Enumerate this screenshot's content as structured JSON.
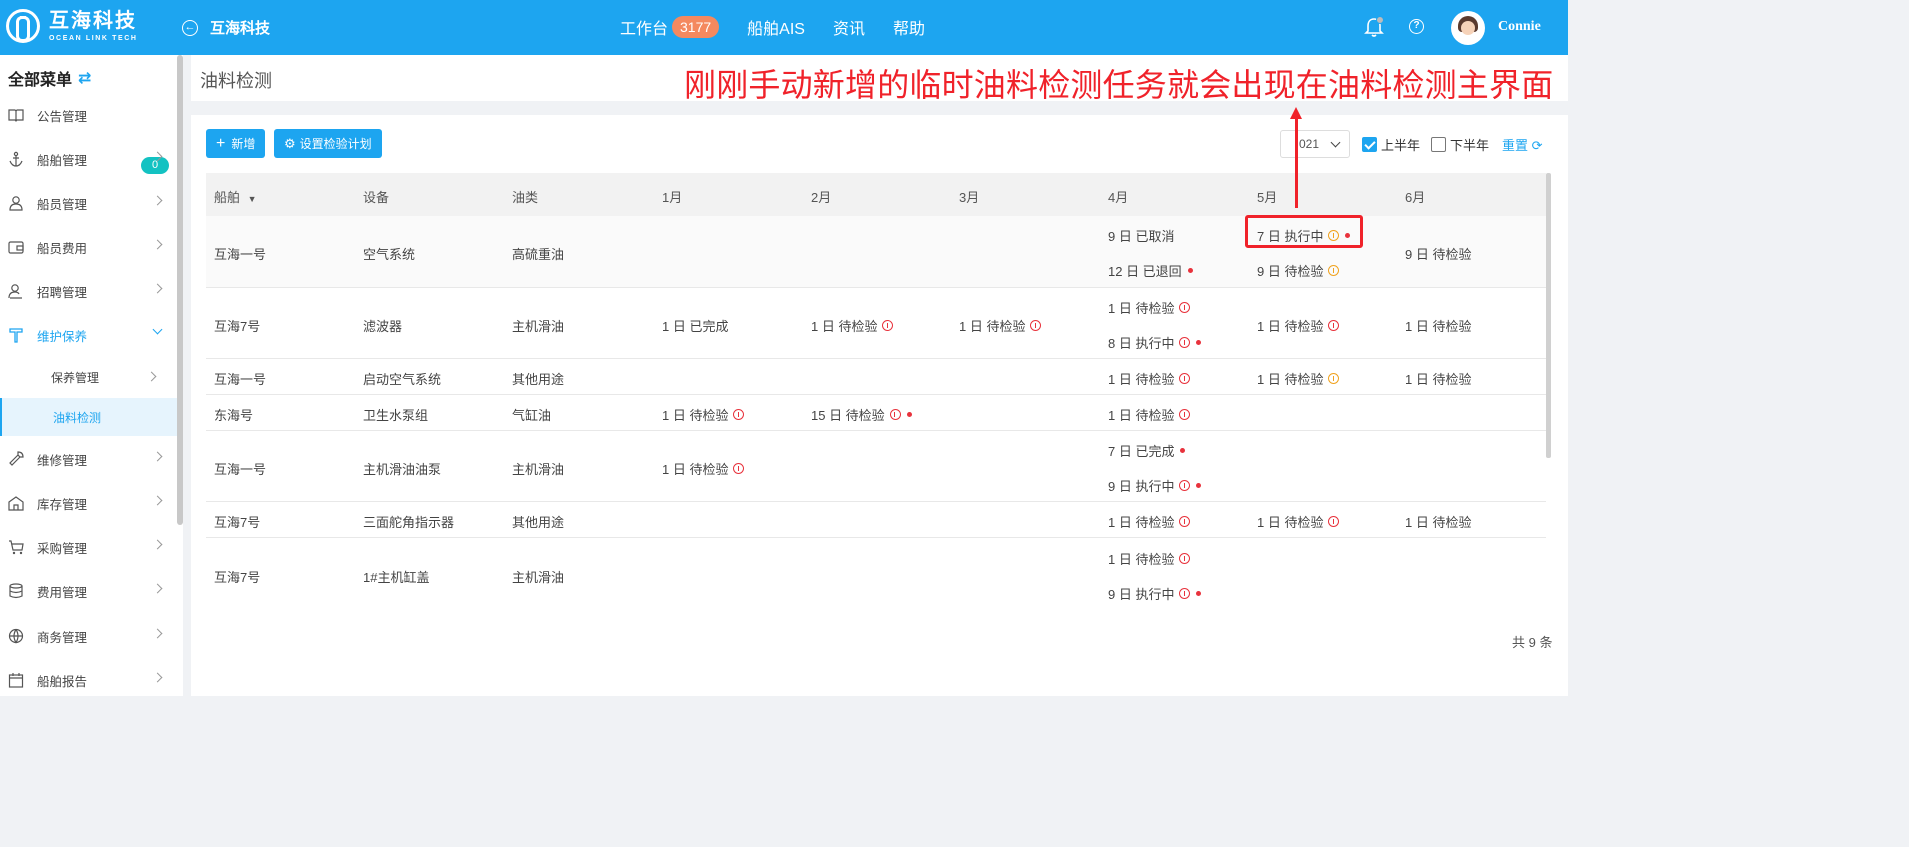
{
  "app": {
    "logo_cn": "互海科技",
    "logo_en": "OCEAN LINK TECH",
    "back_label": "互海科技"
  },
  "nav": {
    "workbench": "工作台",
    "workbench_count": "3177",
    "ais": "船舶AIS",
    "news": "资讯",
    "help": "帮助"
  },
  "user": {
    "name": "Connie"
  },
  "sidebar": {
    "title": "全部菜单",
    "notice_badge": "0",
    "items": [
      {
        "label": "公告管理",
        "icon": "book-icon"
      },
      {
        "label": "船舶管理",
        "icon": "anchor-icon"
      },
      {
        "label": "船员管理",
        "icon": "user-icon"
      },
      {
        "label": "船员费用",
        "icon": "wallet-icon"
      },
      {
        "label": "招聘管理",
        "icon": "user-search-icon"
      },
      {
        "label": "维护保养",
        "icon": "tool-icon"
      },
      {
        "label": "维修管理",
        "icon": "wrench-icon"
      },
      {
        "label": "库存管理",
        "icon": "warehouse-icon"
      },
      {
        "label": "采购管理",
        "icon": "cart-icon"
      },
      {
        "label": "费用管理",
        "icon": "database-icon"
      },
      {
        "label": "商务管理",
        "icon": "globe-icon"
      },
      {
        "label": "船舶报告",
        "icon": "calendar-icon"
      }
    ],
    "subitems": [
      {
        "label": "保养管理"
      },
      {
        "label": "油料检测"
      }
    ]
  },
  "page": {
    "title": "油料检测"
  },
  "annotation": "刚刚手动新增的临时油料检测任务就会出现在油料检测主界面",
  "toolbar": {
    "add_label": "新增",
    "plan_label": "设置检验计划",
    "year": "021",
    "first_half": "上半年",
    "second_half": "下半年",
    "reset": "重置"
  },
  "table": {
    "headers": [
      "船舶",
      "设备",
      "油类",
      "1月",
      "2月",
      "3月",
      "4月",
      "5月",
      "6月"
    ],
    "rows": [
      {
        "ship": "互海一号",
        "equip": "空气系统",
        "oil": "高硫重油",
        "m4a": "9 日 已取消",
        "m4b": "12 日 已退回",
        "m5a": "7 日 执行中",
        "m5b": "9 日 待检验",
        "m6": "9 日 待检验"
      },
      {
        "ship": "互海7号",
        "equip": "滤波器",
        "oil": "主机滑油",
        "m1": "1 日 已完成",
        "m2": "1 日 待检验",
        "m3": "1 日 待检验",
        "m4a": "1 日 待检验",
        "m4b": "8 日 执行中",
        "m5": "1 日 待检验",
        "m6": "1 日 待检验"
      },
      {
        "ship": "互海一号",
        "equip": "启动空气系统",
        "oil": "其他用途",
        "m4": "1 日 待检验",
        "m5": "1 日 待检验",
        "m6": "1 日 待检验"
      },
      {
        "ship": "东海号",
        "equip": "卫生水泵组",
        "oil": "气缸油",
        "m1": "1 日 待检验",
        "m2": "15 日 待检验",
        "m4": "1 日 待检验"
      },
      {
        "ship": "互海一号",
        "equip": "主机滑油油泵",
        "oil": "主机滑油",
        "m1": "1 日 待检验",
        "m4a": "7 日 已完成",
        "m4b": "9 日 执行中"
      },
      {
        "ship": "互海7号",
        "equip": "三面舵角指示器",
        "oil": "其他用途",
        "m4": "1 日 待检验",
        "m5": "1 日 待检验",
        "m6": "1 日 待检验"
      },
      {
        "ship": "互海7号",
        "equip": "1#主机缸盖",
        "oil": "主机滑油",
        "m4a": "1 日 待检验",
        "m4b": "9 日 执行中"
      }
    ],
    "total": "共 9 条"
  },
  "colors": {
    "brand": "#1da5f0",
    "warn_red": "#e8323c",
    "pending_orange": "#f0a320",
    "annotation_red": "#f0222a"
  }
}
